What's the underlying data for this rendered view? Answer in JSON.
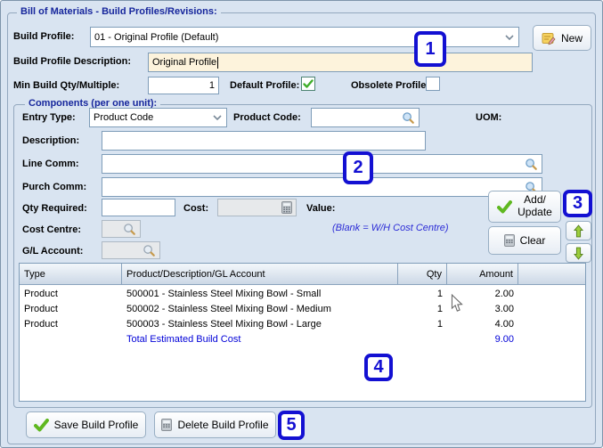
{
  "window": {
    "title": "Bill of Materials - Build Profiles/Revisions:"
  },
  "header": {
    "build_profile_label": "Build Profile:",
    "build_profile_value": "01 - Original Profile (Default)",
    "new_button": "New",
    "description_label": "Build Profile Description:",
    "description_value": "Original Profile",
    "min_build_label": "Min Build Qty/Multiple:",
    "min_build_value": "1",
    "default_profile_label": "Default Profile:",
    "default_profile_checked": true,
    "obsolete_profile_label": "Obsolete Profile:",
    "obsolete_profile_checked": false
  },
  "components": {
    "title": "Components (per one unit):",
    "entry_type_label": "Entry Type:",
    "entry_type_value": "Product Code",
    "product_code_label": "Product Code:",
    "product_code_value": "",
    "uom_label": "UOM:",
    "description_label": "Description:",
    "description_value": "",
    "line_comm_label": "Line Comm:",
    "line_comm_value": "",
    "purch_comm_label": "Purch Comm:",
    "purch_comm_value": "",
    "qty_required_label": "Qty Required:",
    "qty_required_value": "",
    "cost_label": "Cost:",
    "cost_value": "",
    "value_label": "Value:",
    "cost_centre_label": "Cost Centre:",
    "cost_centre_value": "",
    "cost_centre_hint": "(Blank = W/H Cost Centre)",
    "gl_account_label": "G/L Account:",
    "gl_account_value": "",
    "add_update_line1": "Add/",
    "add_update_line2": "Update",
    "clear_button": "Clear"
  },
  "table": {
    "columns": [
      "Type",
      "Product/Description/GL Account",
      "Qty",
      "Amount"
    ],
    "rows": [
      {
        "type": "Product",
        "description": "500001 - Stainless Steel Mixing Bowl - Small",
        "qty": "1",
        "amount": "2.00"
      },
      {
        "type": "Product",
        "description": "500002 - Stainless Steel Mixing Bowl - Medium",
        "qty": "1",
        "amount": "3.00"
      },
      {
        "type": "Product",
        "description": "500003 - Stainless Steel Mixing Bowl - Large",
        "qty": "1",
        "amount": "4.00"
      }
    ],
    "total_row": {
      "label": "Total Estimated Build Cost",
      "amount": "9.00"
    }
  },
  "footer": {
    "save_button": "Save Build Profile",
    "delete_button": "Delete Build Profile"
  },
  "annotations": {
    "m1": "1",
    "m2": "2",
    "m3": "3",
    "m4": "4",
    "m5": "5"
  },
  "colors": {
    "window_bg": "#d9e4f1",
    "group_title": "#16269c",
    "annotation_blue": "#1310d2",
    "total_blue": "#0000d8",
    "description_bg": "#fdf3dc",
    "check_green": "#5fb820",
    "arrow_green": "#9ccd3c"
  }
}
